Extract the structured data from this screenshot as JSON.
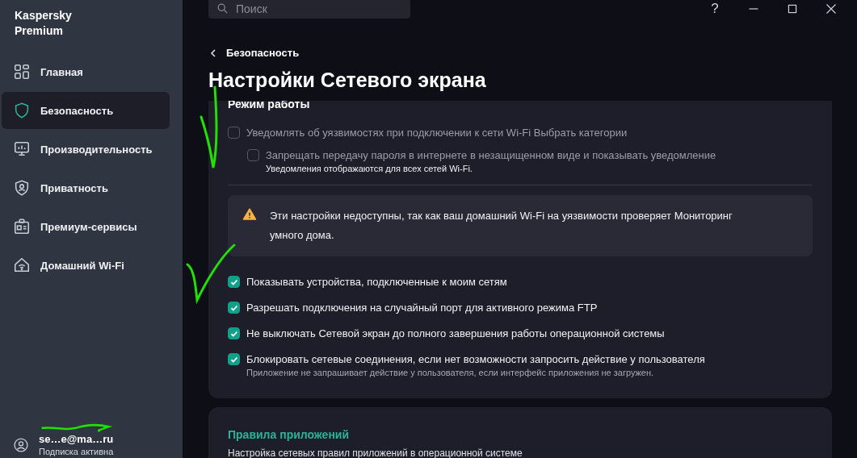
{
  "app": {
    "title": "Kaspersky Premium"
  },
  "sidebar": {
    "items": [
      {
        "label": "Главная",
        "selected": false
      },
      {
        "label": "Безопасность",
        "selected": true
      },
      {
        "label": "Производительность",
        "selected": false
      },
      {
        "label": "Приватность",
        "selected": false
      },
      {
        "label": "Премиум-сервисы",
        "selected": false
      },
      {
        "label": "Домашний Wi-Fi",
        "selected": false
      }
    ]
  },
  "account": {
    "email": "se…e@ma…ru",
    "status": "Подписка активна",
    "redacted": true
  },
  "search": {
    "placeholder": "Поиск"
  },
  "window_controls": {
    "help": "?"
  },
  "breadcrumb": "Безопасность",
  "title": "Настройки Сетевого экрана",
  "section": {
    "heading": "Режим работы",
    "options": [
      {
        "label": "Уведомлять об уязвимостях при подключении к сети Wi-Fi Выбрать категории",
        "checked": false,
        "disabled": true,
        "nested": false
      },
      {
        "label": "Запрещать передачу пароля в интернете в незащищенном виде и показывать уведомление",
        "checked": false,
        "disabled": true,
        "nested": true,
        "hint": "Уведомления отображаются для всех сетей Wi-Fi."
      }
    ],
    "warning": "Эти настройки недоступны, так как ваш домашний Wi-Fi на уязвимости проверяет Мониторинг умного дома.",
    "options_2": [
      {
        "label": "Показывать устройства, подключенные к моим сетям",
        "checked": true,
        "disabled": false
      },
      {
        "label": "Разрешать подключения на случайный порт для активного режима FTP",
        "checked": true,
        "disabled": false
      },
      {
        "label": "Не выключать Сетевой экран до полного завершения работы операционной системы",
        "checked": true,
        "disabled": false
      },
      {
        "label": "Блокировать сетевые соединения, если нет возможности запросить действие у пользователя",
        "checked": true,
        "disabled": false,
        "hint": "Приложение не запрашивает действие у пользователя, если интерфейс приложения не загружен."
      }
    ]
  },
  "app_rules": {
    "title": "Правила приложений",
    "description": "Настройка сетевых правил приложений в операционной системе"
  },
  "annotations": [
    {
      "kind": "checkmark"
    },
    {
      "kind": "checkmark"
    }
  ]
}
